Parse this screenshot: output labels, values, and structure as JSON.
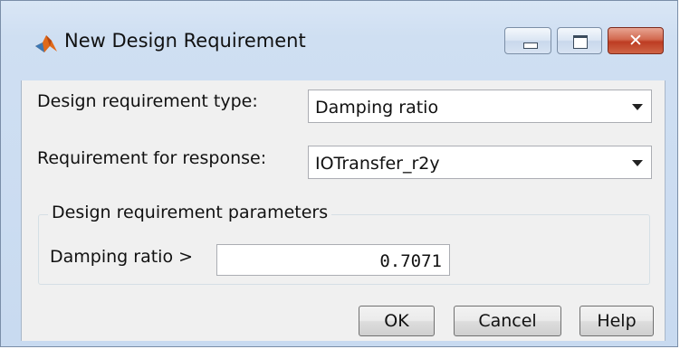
{
  "window": {
    "title": "New Design Requirement",
    "close_glyph": "✕",
    "icons": {
      "app": "matlab-logo-icon",
      "minimize": "minimize-icon",
      "maximize": "maximize-icon",
      "close": "close-icon",
      "dropdown": "chevron-down-icon"
    }
  },
  "form": {
    "requirement_type_label": "Design requirement type:",
    "requirement_type_value": "Damping ratio",
    "response_label": "Requirement for response:",
    "response_value": "IOTransfer_r2y"
  },
  "parameters": {
    "group_title": "Design requirement parameters",
    "damping_label": "Damping ratio >",
    "damping_value": "0.7071"
  },
  "buttons": {
    "ok": "OK",
    "cancel": "Cancel",
    "help": "Help"
  },
  "colors": {
    "frame": "#cfdff2",
    "close_button": "#c7472d",
    "dialog_background": "#f0f0f0"
  }
}
